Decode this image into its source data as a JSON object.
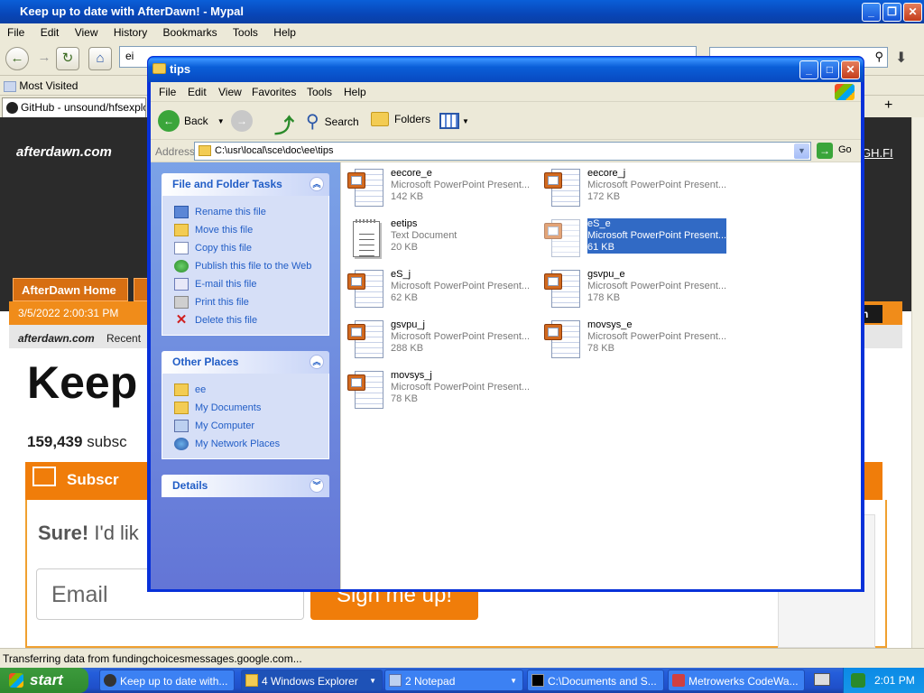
{
  "firefox": {
    "title": "Keep up to date with AfterDawn! - Mypal",
    "menu": [
      "File",
      "Edit",
      "View",
      "History",
      "Bookmarks",
      "Tools",
      "Help"
    ],
    "bookmark": "Most Visited",
    "tab": "GitHub - unsound/hfsexplorer",
    "url_fragment": "ei",
    "status": "Transferring data from fundingchoicesmessages.google.com..."
  },
  "afterdawn": {
    "logo": "afterdawn.com",
    "home_tab": "AfterDawn Home",
    "right_link": "GH.FI",
    "date": "3/5/2022 2:00:31 PM",
    "right_badge": "wn",
    "logo_small": "afterdawn.com",
    "recent": "Recent",
    "headline": "Keep",
    "subscribers_count": "159,439",
    "subscribers_text": "subsc",
    "subscribe_btn": "Subscr",
    "sure_bold": "Sure!",
    "sure_text": "I'd lik",
    "email_placeholder": "Email",
    "signup_btn": "Sign me up!"
  },
  "explorer": {
    "title": "tips",
    "menu": [
      "File",
      "Edit",
      "View",
      "Favorites",
      "Tools",
      "Help"
    ],
    "toolbar": {
      "back": "Back",
      "search": "Search",
      "folders": "Folders"
    },
    "address_label": "Address",
    "address": "C:\\usr\\local\\sce\\doc\\ee\\tips",
    "go": "Go",
    "file_tasks": {
      "title": "File and Folder Tasks",
      "items": [
        "Rename this file",
        "Move this file",
        "Copy this file",
        "Publish this file to the Web",
        "E-mail this file",
        "Print this file",
        "Delete this file"
      ]
    },
    "other_places": {
      "title": "Other Places",
      "items": [
        "ee",
        "My Documents",
        "My Computer",
        "My Network Places"
      ]
    },
    "details": {
      "title": "Details"
    },
    "files": [
      {
        "name": "eecore_e",
        "type": "Microsoft PowerPoint Present...",
        "size": "142 KB",
        "icon": "ppt-icon"
      },
      {
        "name": "eecore_j",
        "type": "Microsoft PowerPoint Present...",
        "size": "172 KB",
        "icon": "ppt-icon"
      },
      {
        "name": "eetips",
        "type": "Text Document",
        "size": "20 KB",
        "icon": "text-icon"
      },
      {
        "name": "eS_e",
        "type": "Microsoft PowerPoint Present...",
        "size": "61 KB",
        "icon": "ppt-icon",
        "selected": true
      },
      {
        "name": "eS_j",
        "type": "Microsoft PowerPoint Present...",
        "size": "62 KB",
        "icon": "ppt-icon"
      },
      {
        "name": "gsvpu_e",
        "type": "Microsoft PowerPoint Present...",
        "size": "178 KB",
        "icon": "ppt-icon"
      },
      {
        "name": "gsvpu_j",
        "type": "Microsoft PowerPoint Present...",
        "size": "288 KB",
        "icon": "ppt-icon"
      },
      {
        "name": "movsys_e",
        "type": "Microsoft PowerPoint Present...",
        "size": "78 KB",
        "icon": "ppt-icon"
      },
      {
        "name": "movsys_j",
        "type": "Microsoft PowerPoint Present...",
        "size": "78 KB",
        "icon": "ppt-icon"
      }
    ]
  },
  "taskbar": {
    "start": "start",
    "tasks": [
      "Keep up to date with...",
      "4 Windows Explorer",
      "2 Notepad",
      "C:\\Documents and S...",
      "Metrowerks CodeWa..."
    ],
    "clock": "2:01 PM"
  },
  "colors": {
    "xp_blue": "#0831d9",
    "selection": "#316ac5",
    "afterdawn_orange": "#f07d0a",
    "start_green": "#3c9a3c"
  }
}
